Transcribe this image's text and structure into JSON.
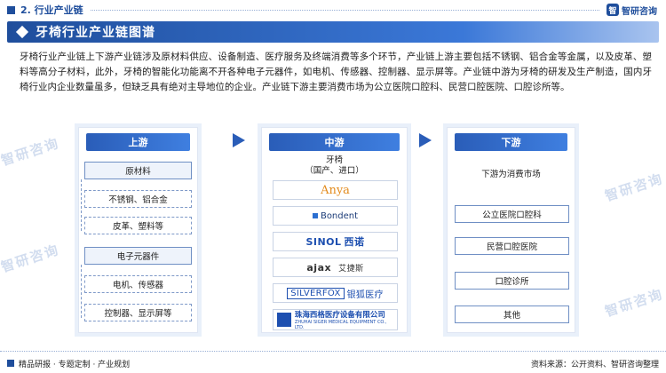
{
  "header": {
    "section": "2. 行业产业链",
    "logo_text": "智研咨询",
    "logo_mark": "智"
  },
  "title": "牙椅行业产业链图谱",
  "intro": "牙椅行业产业链上下游产业链涉及原材料供应、设备制造、医疗服务及终端消费等多个环节，产业链上游主要包括不锈钢、铝合金等金属，以及皮革、塑料等高分子材料，此外，牙椅的智能化功能离不开各种电子元器件，如电机、传感器、控制器、显示屏等。产业链中游为牙椅的研发及生产制造，国内牙椅行业内企业数量虽多，但缺乏具有绝对主导地位的企业。产业链下游主要消费市场为公立医院口腔科、民营口腔医院、口腔诊所等。",
  "upstream": {
    "head": "上游",
    "group1": {
      "main": "原材料",
      "subs": [
        "不锈钢、铝合金",
        "皮革、塑料等"
      ]
    },
    "group2": {
      "main": "电子元器件",
      "subs": [
        "电机、传感器",
        "控制器、显示屏等"
      ]
    }
  },
  "midstream": {
    "head": "中游",
    "label_line1": "牙椅",
    "label_line2": "（国产、进口）",
    "brands": {
      "anya": "Anya",
      "bondent": "Bondent",
      "sinol_en": "SINOL",
      "sinol_cn": "西诺",
      "ajax_en": "ajax",
      "ajax_cn": "艾捷斯",
      "silverfox_en": "SILVERFOX",
      "silverfox_cn": "银狐医疗",
      "siger_cn": "珠海西格医疗设备有限公司",
      "siger_en": "ZHUHAI SIGER MEDICAL EQUIPMENT CO., LTD."
    }
  },
  "downstream": {
    "head": "下游",
    "label": "下游为消费市场",
    "items": [
      "公立医院口腔科",
      "民营口腔医院",
      "口腔诊所",
      "其他"
    ]
  },
  "footer": {
    "tagline": "精品研报 · 专题定制 · 产业规划",
    "source": "资料来源：公开资料、智研咨询整理"
  },
  "watermark": "智研咨询"
}
